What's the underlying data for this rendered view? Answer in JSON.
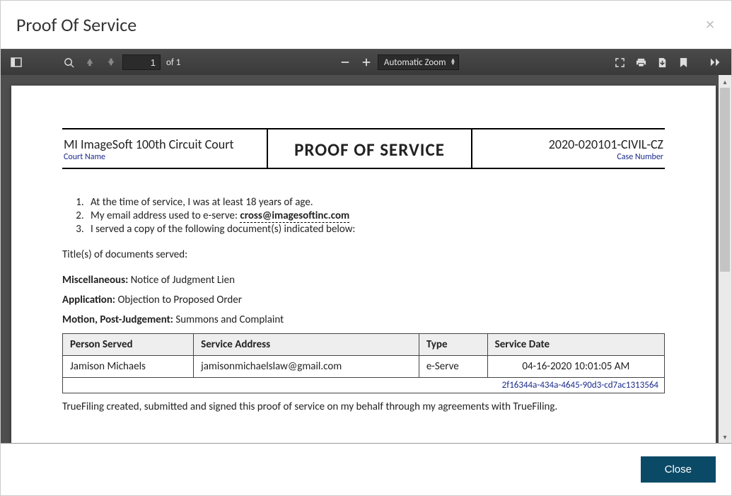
{
  "modal": {
    "title": "Proof Of Service",
    "close_x": "×",
    "close_button": "Close"
  },
  "toolbar": {
    "page_current": "1",
    "page_total_label": "of 1",
    "zoom_label": "Automatic Zoom"
  },
  "doc": {
    "header": {
      "court": "MI ImageSoft 100th Circuit Court",
      "court_label": "Court Name",
      "title": "PROOF OF SERVICE",
      "case_number": "2020-020101-CIVIL-CZ",
      "case_label": "Case Number"
    },
    "statements": [
      "At the time of service, I was at least 18 years of age.",
      "My email address used to e-serve:",
      "I served a copy of the following document(s) indicated below:"
    ],
    "email": "cross@imagesoftinc.com",
    "titles_heading": "Title(s) of documents served:",
    "documents": [
      {
        "label": "Miscellaneous:",
        "value": "Notice of Judgment Lien"
      },
      {
        "label": "Application:",
        "value": "Objection to Proposed Order"
      },
      {
        "label": "Motion, Post-Judgement:",
        "value": "Summons and Complaint"
      }
    ],
    "service_table": {
      "headers": [
        "Person Served",
        "Service Address",
        "Type",
        "Service Date"
      ],
      "rows": [
        {
          "person": "Jamison Michaels",
          "address": "jamisonmichaelslaw@gmail.com",
          "type": "e-Serve",
          "date": "04-16-2020  10:01:05 AM"
        }
      ],
      "reference": "2f16344a-434a-4645-90d3-cd7ac1313564"
    },
    "footer_note": "TrueFiling created, submitted and signed this proof of service on my behalf through my agreements with TrueFiling."
  }
}
